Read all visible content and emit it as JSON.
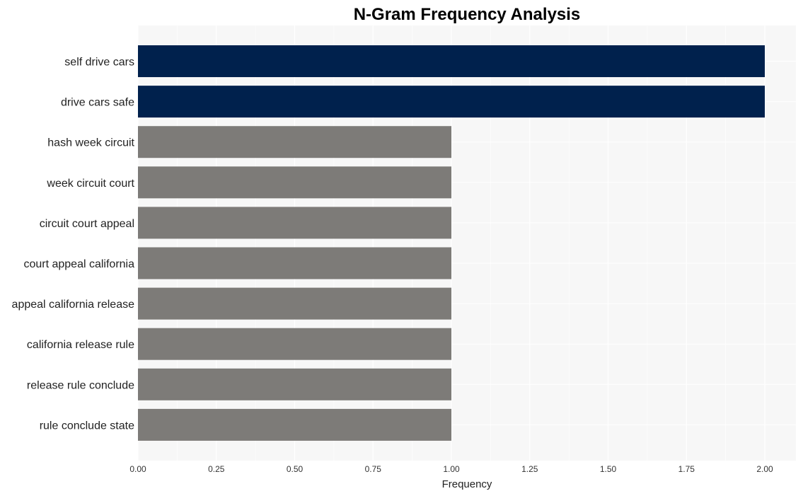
{
  "chart_data": {
    "type": "bar",
    "orientation": "horizontal",
    "title": "N-Gram Frequency Analysis",
    "xlabel": "Frequency",
    "ylabel": "",
    "xlim": [
      0,
      2.1
    ],
    "grid": true,
    "xticks": [
      "0.00",
      "0.25",
      "0.50",
      "0.75",
      "1.00",
      "1.25",
      "1.50",
      "1.75",
      "2.00"
    ],
    "tick_values": [
      0,
      0.25,
      0.5,
      0.75,
      1.0,
      1.25,
      1.5,
      1.75,
      2.0
    ],
    "categories": [
      "self drive cars",
      "drive cars safe",
      "hash week circuit",
      "week circuit court",
      "circuit court appeal",
      "court appeal california",
      "appeal california release",
      "california release rule",
      "release rule conclude",
      "rule conclude state"
    ],
    "values": [
      2,
      2,
      1,
      1,
      1,
      1,
      1,
      1,
      1,
      1
    ],
    "colors": {
      "highlight": "#00214d",
      "default": "#7d7b78",
      "plot_background": "#f7f7f7",
      "grid": "#ffffff"
    }
  }
}
